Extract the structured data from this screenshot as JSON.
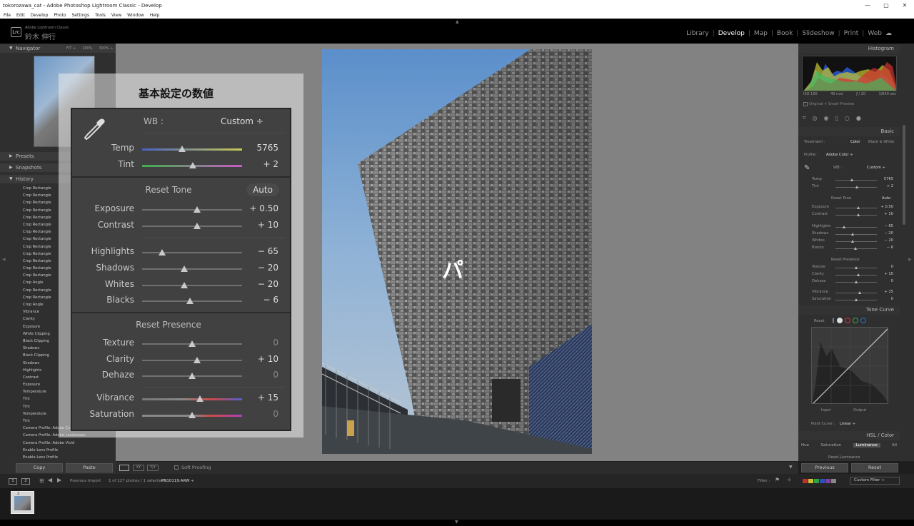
{
  "window": {
    "title": "tokorozawa_cat - Adobe Photoshop Lightroom Classic - Develop"
  },
  "menu": [
    "File",
    "Edit",
    "Develop",
    "Photo",
    "Settings",
    "Tools",
    "View",
    "Window",
    "Help"
  ],
  "app": {
    "logo": "Lrc",
    "name": "Adobe Lightroom Classic",
    "user": "鈴木 伸行"
  },
  "modules": [
    {
      "label": "Library",
      "active": false
    },
    {
      "label": "Develop",
      "active": true
    },
    {
      "label": "Map",
      "active": false
    },
    {
      "label": "Book",
      "active": false
    },
    {
      "label": "Slideshow",
      "active": false
    },
    {
      "label": "Print",
      "active": false
    },
    {
      "label": "Web",
      "active": false
    }
  ],
  "left": {
    "navigator": "Navigator",
    "nav_zoom": [
      "FIT ÷",
      "100%",
      "300% ÷"
    ],
    "presets": "Presets",
    "snapshots": "Snapshots",
    "history_title": "History",
    "history": [
      "Crop Rectangle",
      "Crop Rectangle",
      "Crop Rectangle",
      "Crop Rectangle",
      "Crop Rectangle",
      "Crop Rectangle",
      "Crop Rectangle",
      "Crop Rectangle",
      "Crop Rectangle",
      "Crop Rectangle",
      "Crop Rectangle",
      "Crop Rectangle",
      "Crop Rectangle",
      "Crop Angle",
      "Crop Rectangle",
      "Crop Rectangle",
      "Crop Angle",
      "Vibrance",
      "Clarity",
      "Exposure",
      "White Clipping",
      "Black Clipping",
      "Shadows",
      "Black Clipping",
      "Shadows",
      "Highlights",
      "Contrast",
      "Exposure",
      "Temperature",
      "Tint",
      "Tint",
      "Temperature",
      "Tint",
      "Camera Profile: Adobe Co",
      "Camera Profile: Adobe Landscape",
      "Camera Profile: Adobe Vivid",
      "Enable Lens Profile",
      "Enable Lens Profile"
    ],
    "copy": "Copy",
    "paste": "Paste"
  },
  "overlay": {
    "title": "基本設定の数値",
    "wb_label": "WB :",
    "wb_value": "Custom ÷",
    "reset_tone": "Reset Tone",
    "auto": "Auto",
    "reset_presence": "Reset Presence",
    "sliders": {
      "temp": {
        "label": "Temp",
        "value": "5765",
        "pos": 0.4
      },
      "tint": {
        "label": "Tint",
        "value": "+ 2",
        "pos": 0.51
      },
      "exposure": {
        "label": "Exposure",
        "value": "+ 0.50",
        "pos": 0.55
      },
      "contrast": {
        "label": "Contrast",
        "value": "+ 10",
        "pos": 0.55
      },
      "highlights": {
        "label": "Highlights",
        "value": "− 65",
        "pos": 0.2
      },
      "shadows": {
        "label": "Shadows",
        "value": "− 20",
        "pos": 0.42
      },
      "whites": {
        "label": "Whites",
        "value": "− 20",
        "pos": 0.42
      },
      "blacks": {
        "label": "Blacks",
        "value": "− 6",
        "pos": 0.48
      },
      "texture": {
        "label": "Texture",
        "value": "0",
        "pos": 0.5
      },
      "clarity": {
        "label": "Clarity",
        "value": "+ 10",
        "pos": 0.55
      },
      "dehaze": {
        "label": "Dehaze",
        "value": "0",
        "pos": 0.5
      },
      "vibrance": {
        "label": "Vibrance",
        "value": "+ 15",
        "pos": 0.58
      },
      "saturation": {
        "label": "Saturation",
        "value": "0",
        "pos": 0.5
      }
    }
  },
  "right": {
    "histogram": "Histogram",
    "histo_labels": [
      "ISO 100",
      "40 mm",
      "ƒ / 20",
      "1/640 sec"
    ],
    "original_preview": "Original + Smart Preview",
    "basic": "Basic",
    "treatment": "Treatment :",
    "color": "Color",
    "bw": "Black & White",
    "profile": "Profile :",
    "profile_value": "Adobe Color ÷",
    "wb": "WB :",
    "wb_value": "Custom ÷",
    "reset_tone": "Reset Tone",
    "auto": "Auto",
    "reset_presence": "Reset Presence",
    "tone_curve": "Tone Curve",
    "reset": "Reset",
    "input": "Input",
    "output": "Output",
    "point_curve": "Point Curve :",
    "point_curve_value": "Linear ÷",
    "hsl": "HSL / Color",
    "hsl_tabs": [
      "Hue",
      "Saturation",
      "Luminance",
      "All"
    ],
    "reset_luminance": "Reset Luminance",
    "previous": "Previous",
    "reset_btn": "Reset",
    "colors": {
      "tc_red": "#e03030",
      "tc_green": "#30b040",
      "tc_blue": "#3070e0"
    }
  },
  "toolbar": {
    "soft_proofing": "Soft Proofing"
  },
  "filmstrip": {
    "page1": "1",
    "page2": "2",
    "source": "Previous Import",
    "count": "1 of 127 photos / 1 selected /",
    "filename": "PN10119.ARW ÷",
    "filter_label": "Filter :",
    "filter_value": "Custom Filter ÷",
    "thumb_badge": "2"
  }
}
